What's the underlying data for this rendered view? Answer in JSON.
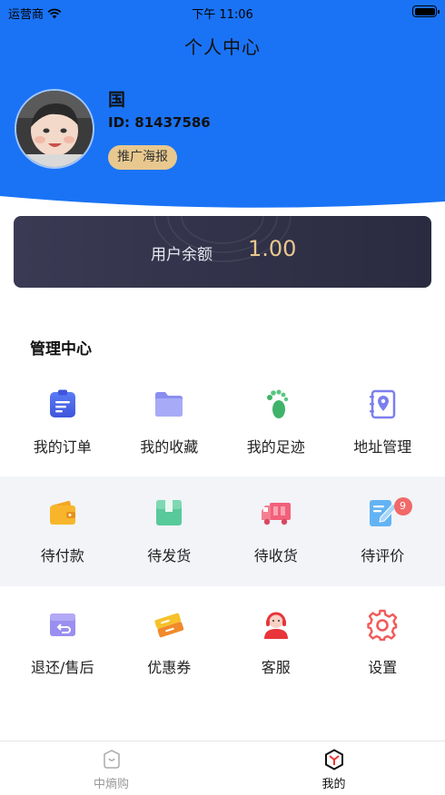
{
  "status_bar": {
    "carrier": "运营商",
    "time": "下午 11:06"
  },
  "nav": {
    "title": "个人中心"
  },
  "profile": {
    "name": "国",
    "id_text": "ID: 81437586",
    "poster_button": "推广海报"
  },
  "balance": {
    "label": "用户余额",
    "value": "1.00"
  },
  "manage": {
    "title": "管理中心"
  },
  "rows": [
    [
      {
        "label": "我的订单",
        "icon": "order-icon"
      },
      {
        "label": "我的收藏",
        "icon": "folder-icon"
      },
      {
        "label": "我的足迹",
        "icon": "footprint-icon"
      },
      {
        "label": "地址管理",
        "icon": "address-icon"
      }
    ],
    [
      {
        "label": "待付款",
        "icon": "wallet-icon"
      },
      {
        "label": "待发货",
        "icon": "package-icon"
      },
      {
        "label": "待收货",
        "icon": "truck-icon"
      },
      {
        "label": "待评价",
        "icon": "review-icon",
        "badge": "9"
      }
    ],
    [
      {
        "label": "退还/售后",
        "icon": "return-icon"
      },
      {
        "label": "优惠券",
        "icon": "coupon-icon"
      },
      {
        "label": "客服",
        "icon": "service-icon"
      },
      {
        "label": "设置",
        "icon": "settings-icon"
      }
    ]
  ],
  "tabs": [
    {
      "label": "中熵购",
      "icon": "home-icon"
    },
    {
      "label": "我的",
      "icon": "mine-icon"
    }
  ],
  "colors": {
    "header_blue": "#1a73f5",
    "gold": "#e8c88e",
    "badge_red": "#f06a6a"
  }
}
